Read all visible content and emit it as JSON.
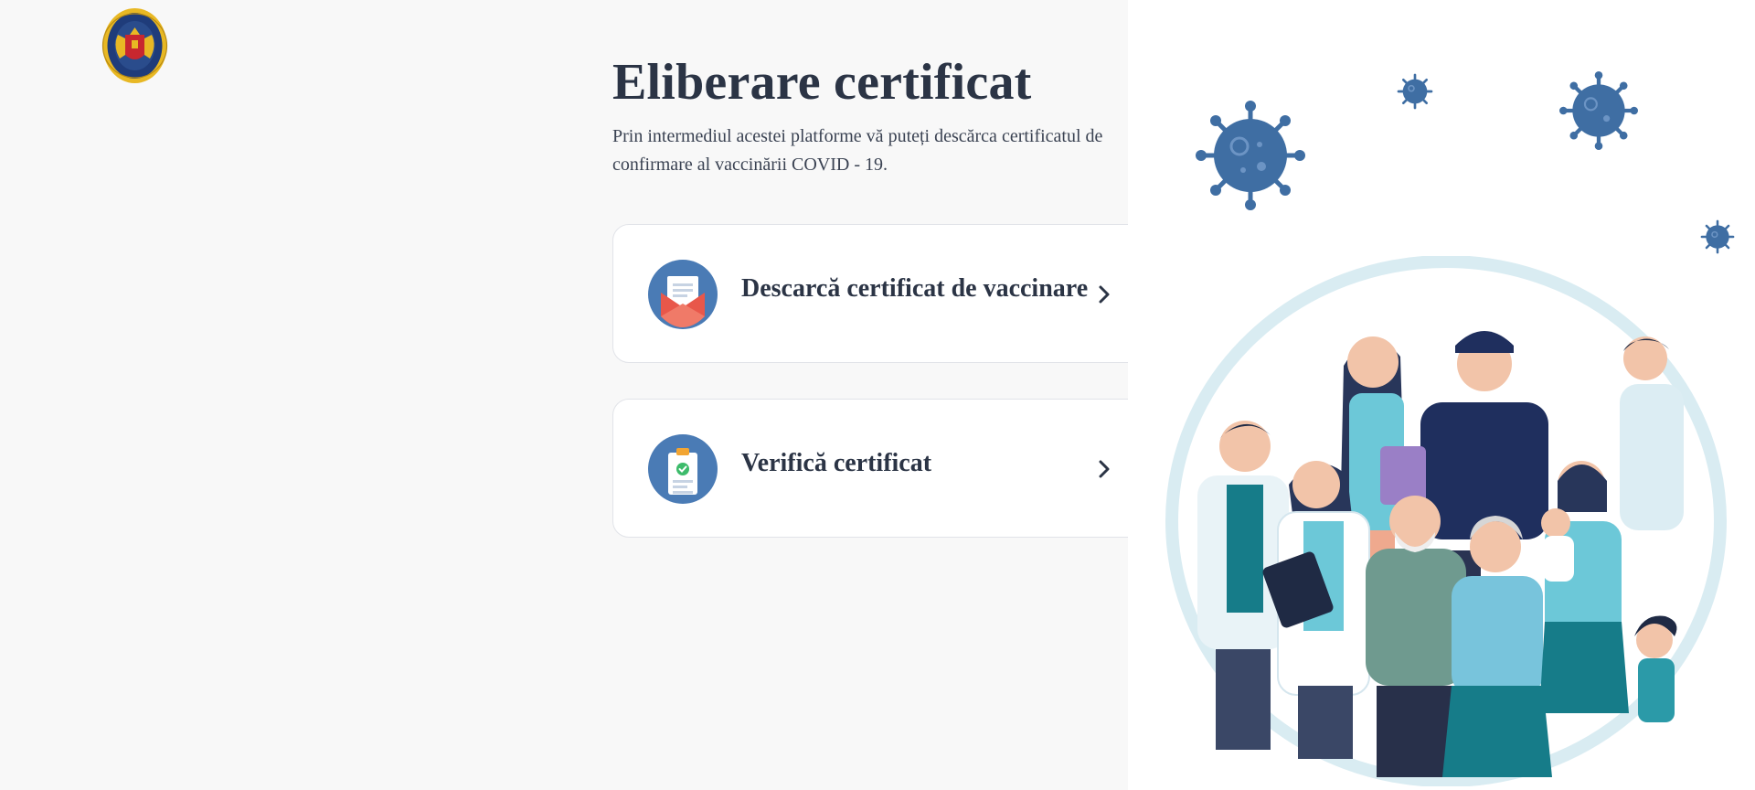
{
  "colors": {
    "background": "#f8f8f8",
    "title": "#2b3445",
    "text": "#3a4252",
    "icon_blue": "#4a7bb5",
    "virus_blue": "#3f6ea3",
    "circle_ring": "#d9ecf2"
  },
  "header": {
    "logo_icon": "moldova-government-coat-of-arms-icon"
  },
  "main": {
    "title": "Eliberare certificat",
    "subtitle": "Prin intermediul acestei platforme vă puteți descărca certificatul de confirmare al vaccinării COVID - 19."
  },
  "actions": [
    {
      "label": "Descarcă certificat de vaccinare",
      "icon": "envelope-certificate-icon",
      "chevron": "chevron-right-icon"
    },
    {
      "label": "Verifică certificat",
      "icon": "clipboard-check-icon",
      "chevron": "chevron-right-icon"
    }
  ],
  "illustration": {
    "description_icon": "community-people-illustration",
    "virus_icon": "coronavirus-icon"
  }
}
